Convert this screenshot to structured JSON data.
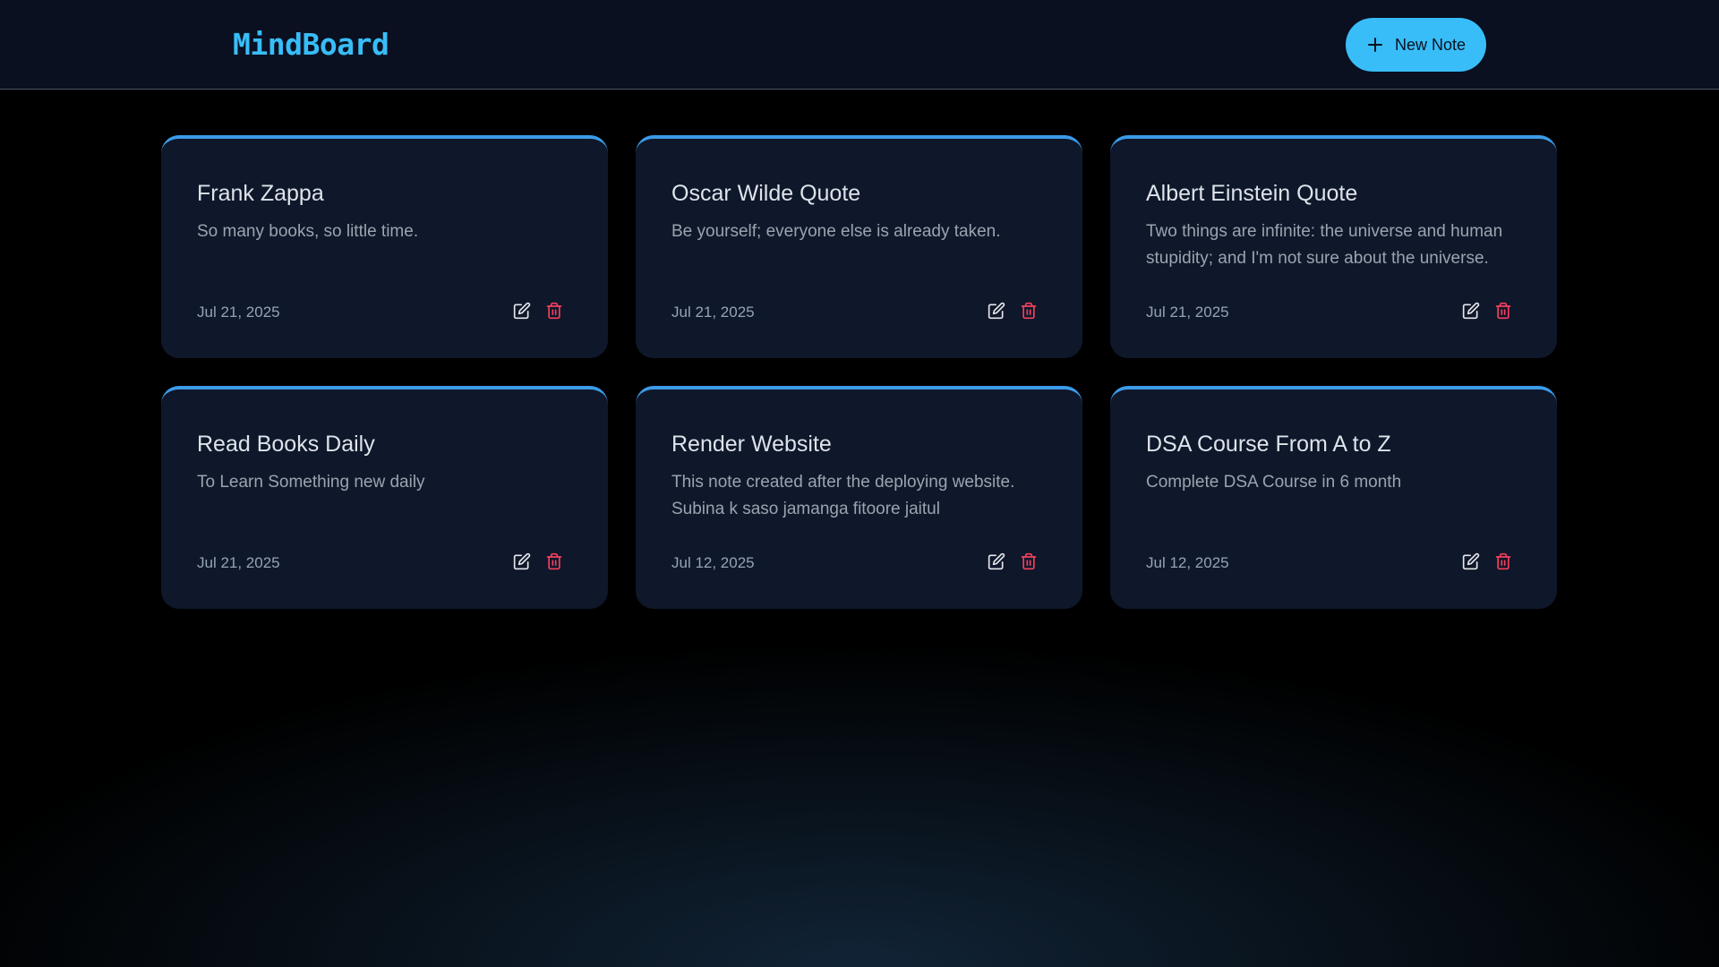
{
  "app": {
    "logo": "MindBoard",
    "new_note_label": "New Note",
    "accent": "#38bdf8",
    "delete_color": "#f43f5e"
  },
  "notes": [
    {
      "title": "Frank Zappa",
      "content": "So many books, so little time.",
      "date": "Jul 21, 2025"
    },
    {
      "title": "Oscar Wilde Quote",
      "content": "Be yourself; everyone else is already taken.",
      "date": "Jul 21, 2025"
    },
    {
      "title": "Albert Einstein Quote",
      "content": "Two things are infinite: the universe and human stupidity; and I'm not sure about the universe.",
      "date": "Jul 21, 2025"
    },
    {
      "title": "Read Books Daily",
      "content": "To Learn Something new daily",
      "date": "Jul 21, 2025"
    },
    {
      "title": "Render Website",
      "content": "This note created after the deploying website. Subina k saso jamanga fitoore jaitul",
      "date": "Jul 12, 2025"
    },
    {
      "title": "DSA Course From A to Z",
      "content": "Complete DSA Course in 6 month",
      "date": "Jul 12, 2025"
    }
  ]
}
